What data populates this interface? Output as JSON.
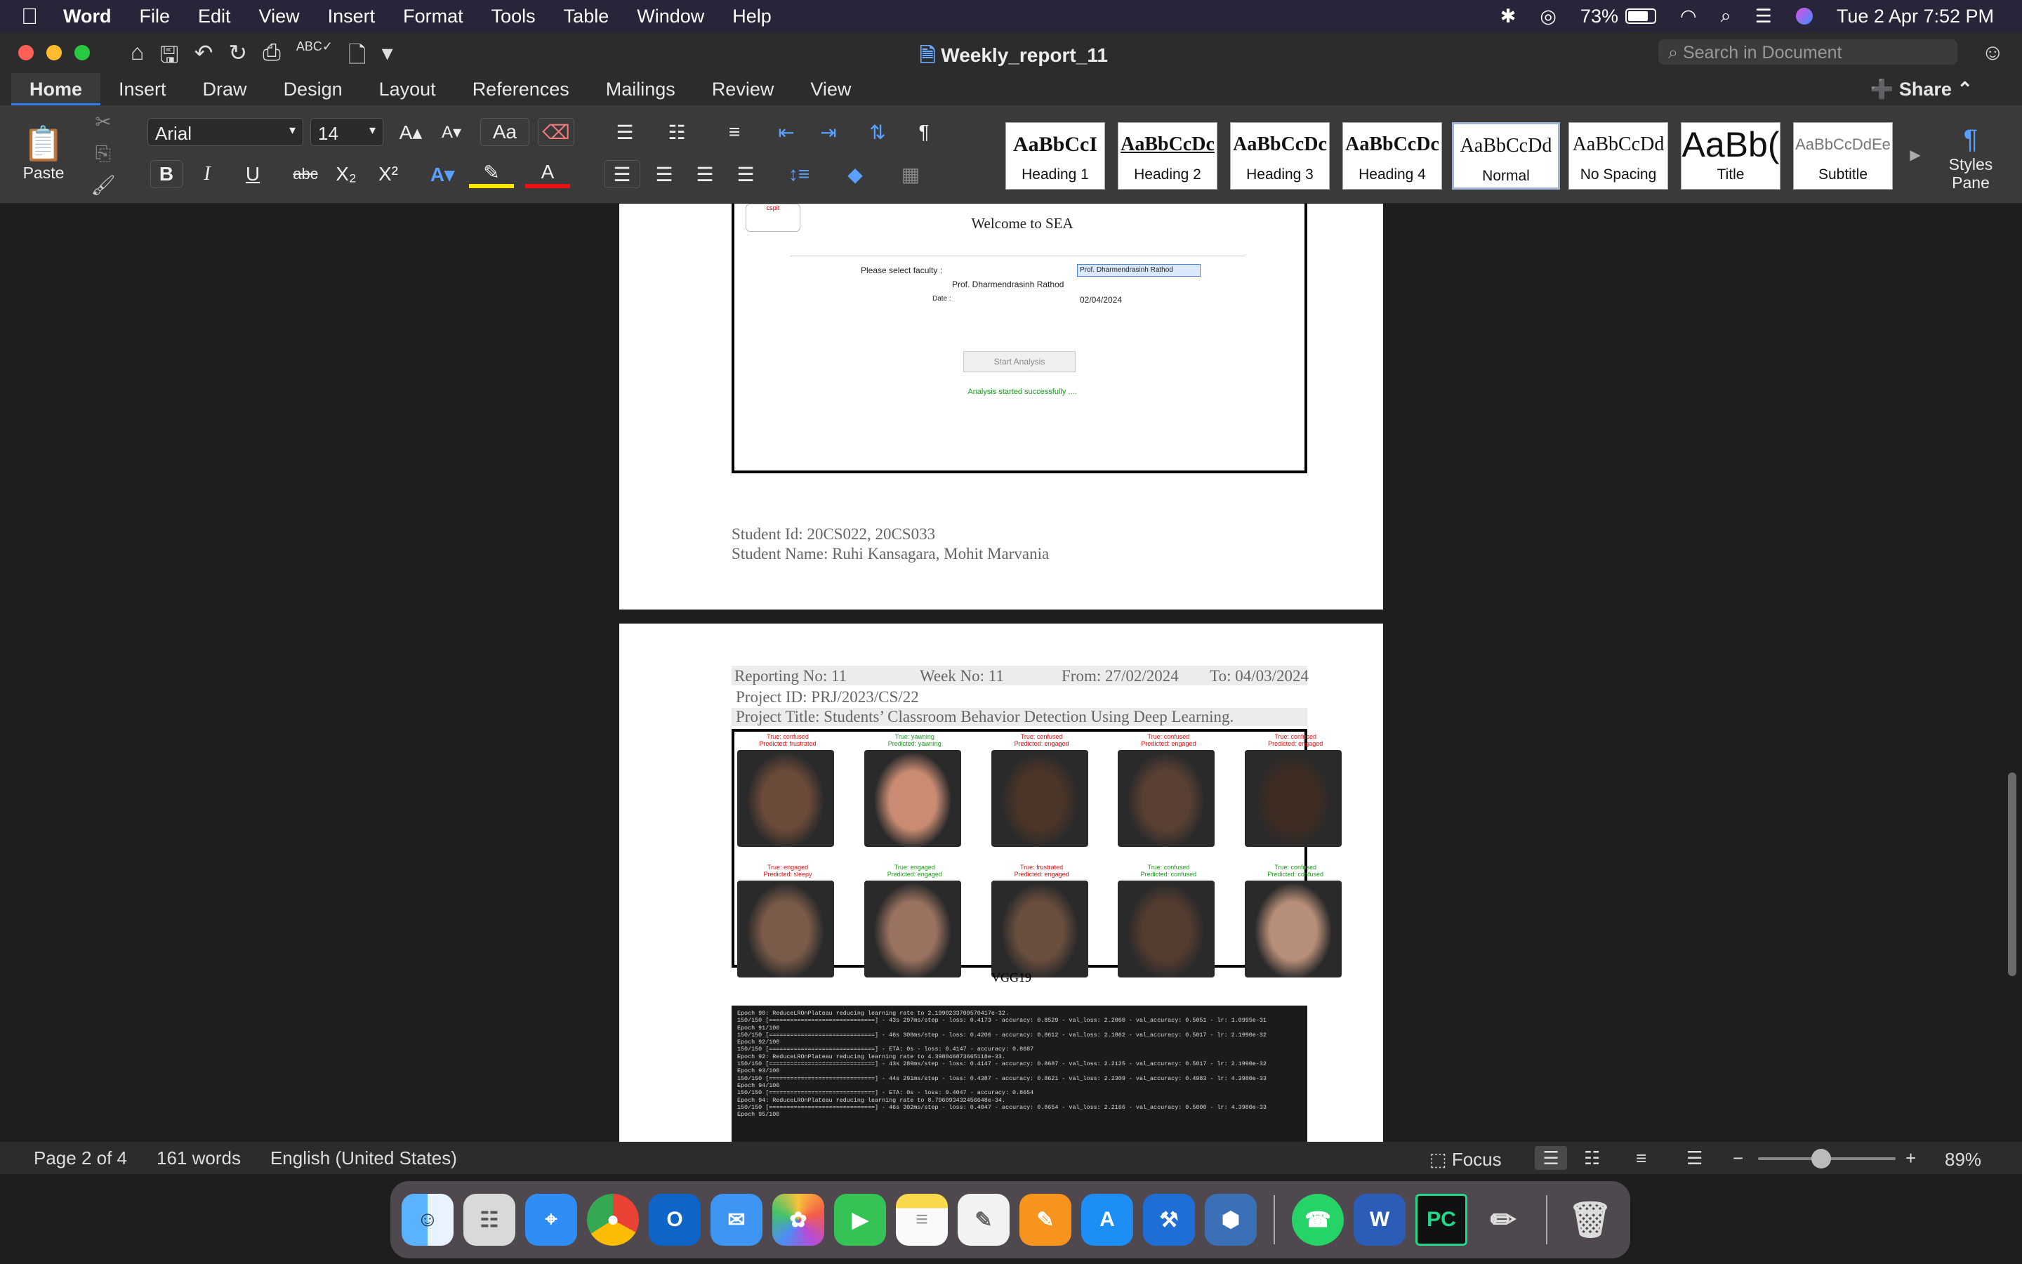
{
  "menubar": {
    "app": "Word",
    "items": [
      "File",
      "Edit",
      "View",
      "Insert",
      "Format",
      "Tools",
      "Table",
      "Window",
      "Help"
    ],
    "battery": "73%",
    "datetime": "Tue 2 Apr  7:52 PM"
  },
  "window": {
    "title": "Weekly_report_11",
    "search_placeholder": "Search in Document"
  },
  "tabs": [
    "Home",
    "Insert",
    "Draw",
    "Design",
    "Layout",
    "References",
    "Mailings",
    "Review",
    "View"
  ],
  "share": "Share",
  "ribbon": {
    "paste": "Paste",
    "font": "Arial",
    "size": "14",
    "styles_pane": "Styles Pane",
    "styles": [
      {
        "preview": "AaBbCcI",
        "label": "Heading 1"
      },
      {
        "preview": "AaBbCcDc",
        "label": "Heading 2"
      },
      {
        "preview": "AaBbCcDc",
        "label": "Heading 3"
      },
      {
        "preview": "AaBbCcDc",
        "label": "Heading 4"
      },
      {
        "preview": "AaBbCcDd",
        "label": "Normal"
      },
      {
        "preview": "AaBbCcDd",
        "label": "No Spacing"
      },
      {
        "preview": "AaBb(",
        "label": "Title"
      },
      {
        "preview": "AaBbCcDdEe",
        "label": "Subtitle"
      }
    ]
  },
  "page1": {
    "sea_title": "Welcome to SEA",
    "select_label": "Please select faculty :",
    "select_value": "Prof. Dharmendrasinh Rathod",
    "faculty": "Prof. Dharmendrasinh Rathod",
    "date_label": "Date :",
    "date": "02/04/2024",
    "button": "Start Analysis",
    "status": "Analysis started successfully ....",
    "student_id": "Student Id: 20CS022, 20CS033",
    "student_name": "Student Name: Ruhi Kansagara, Mohit Marvania"
  },
  "page2": {
    "reporting": "Reporting No: 11",
    "week": "Week No:  11",
    "from": "From: 27/02/2024",
    "to": "To: 04/03/2024",
    "project_id": "Project ID: PRJ/2023/CS/22",
    "project_title": "Project Title: Students’ Classroom Behavior Detection Using Deep Learning.",
    "caption": "VGG19",
    "faces": [
      {
        "t": "True: confused",
        "p": "Predicted: frustrated"
      },
      {
        "t": "True: yawning",
        "p": "Predicted: yawning"
      },
      {
        "t": "True: confused",
        "p": "Predicted: engaged"
      },
      {
        "t": "True: confused",
        "p": "Predicted: engaged"
      },
      {
        "t": "True: confused",
        "p": "Predicted: engaged"
      },
      {
        "t": "True: engaged",
        "p": "Predicted: sleepy"
      },
      {
        "t": "True: engaged",
        "p": "Predicted: engaged"
      },
      {
        "t": "True: frustrated",
        "p": "Predicted: engaged"
      },
      {
        "t": "True: confused",
        "p": "Predicted: confused"
      },
      {
        "t": "True: confused",
        "p": "Predicted: confused"
      }
    ],
    "log": [
      "Epoch 90: ReduceLROnPlateau reducing learning rate to 2.1990233700570417e-32.",
      "150/150 [==============================] - 43s 297ms/step - loss: 0.4173 - accuracy: 0.8529 - val_loss: 2.2060 - val_accuracy: 0.5051 - lr: 1.0995e-31",
      "Epoch 91/100",
      "150/150 [==============================] - 46s 308ms/step - loss: 0.4206 - accuracy: 0.8612 - val_loss: 2.1862 - val_accuracy: 0.5017 - lr: 2.1990e-32",
      "Epoch 92/100",
      "150/150 [==============================] - ETA: 0s - loss: 0.4147 - accuracy: 0.8687",
      "Epoch 92: ReduceLROnPlateau reducing learning rate to 4.398046873665118e-33.",
      "150/150 [==============================] - 43s 289ms/step - loss: 0.4147 - accuracy: 0.8687 - val_loss: 2.2125 - val_accuracy: 0.5017 - lr: 2.1990e-32",
      "Epoch 93/100",
      "150/150 [==============================] - 44s 291ms/step - loss: 0.4387 - accuracy: 0.8621 - val_loss: 2.2309 - val_accuracy: 0.4983 - lr: 4.3980e-33",
      "Epoch 94/100",
      "150/150 [==============================] - ETA: 0s - loss: 0.4047 - accuracy: 0.8654",
      "Epoch 94: ReduceLROnPlateau reducing learning rate to 8.796093432456648e-34.",
      "150/150 [==============================] - 46s 302ms/step - loss: 0.4047 - accuracy: 0.8654 - val_loss: 2.2166 - val_accuracy: 0.5000 - lr: 4.3980e-33",
      "Epoch 95/100"
    ]
  },
  "status": {
    "page": "Page 2 of 4",
    "words": "161 words",
    "lang": "English (United States)",
    "focus": "Focus",
    "zoom": "89%"
  }
}
